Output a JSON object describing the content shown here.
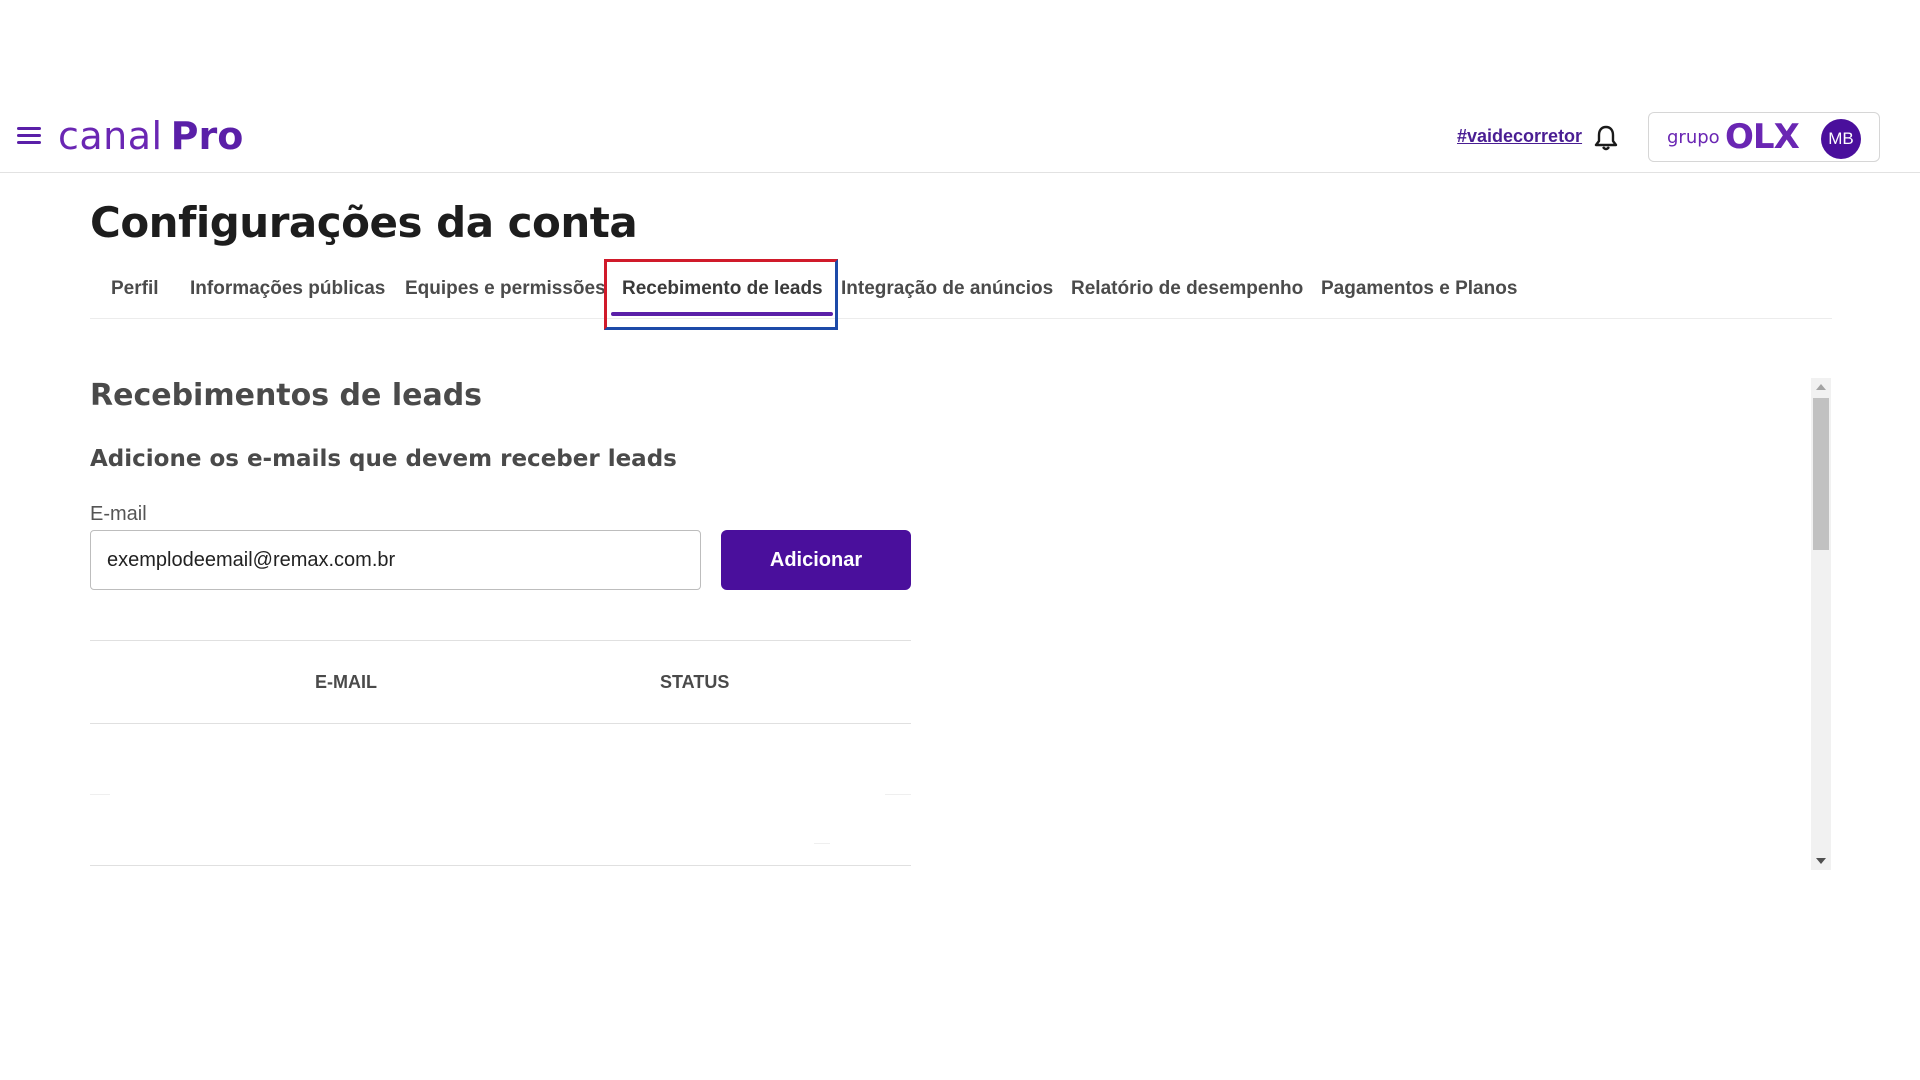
{
  "header": {
    "logo_light": "canal",
    "logo_bold": "Pro",
    "hashtag": "#vaidecorretor",
    "brand_group": "grupo",
    "brand_olx": "OLX",
    "avatar_initials": "MB"
  },
  "page": {
    "title": "Configurações da conta"
  },
  "tabs": [
    {
      "label": "Perfil",
      "active": false
    },
    {
      "label": "Informações públicas",
      "active": false
    },
    {
      "label": "Equipes e permissões",
      "active": false
    },
    {
      "label": "Recebimento de leads",
      "active": true
    },
    {
      "label": "Integração de anúncios",
      "active": false
    },
    {
      "label": "Relatório de desempenho",
      "active": false
    },
    {
      "label": "Pagamentos e Planos",
      "active": false
    }
  ],
  "section": {
    "title": "Recebimentos de leads",
    "subtitle": "Adicione os e-mails que devem receber leads",
    "email_label": "E-mail",
    "email_value": "exemplodeemail@remax.com.br",
    "add_button": "Adicionar"
  },
  "table": {
    "columns": [
      "E-MAIL",
      "STATUS"
    ],
    "rows": []
  },
  "colors": {
    "brand_purple": "#4a0f9c",
    "accent_purple": "#6a26b3",
    "highlight_red": "#d01a2a",
    "highlight_blue": "#1d4aa8"
  },
  "icons": {
    "menu": "menu-icon",
    "notifications": "bell-icon",
    "scroll_up": "arrow-up-icon",
    "scroll_down": "arrow-down-icon"
  }
}
